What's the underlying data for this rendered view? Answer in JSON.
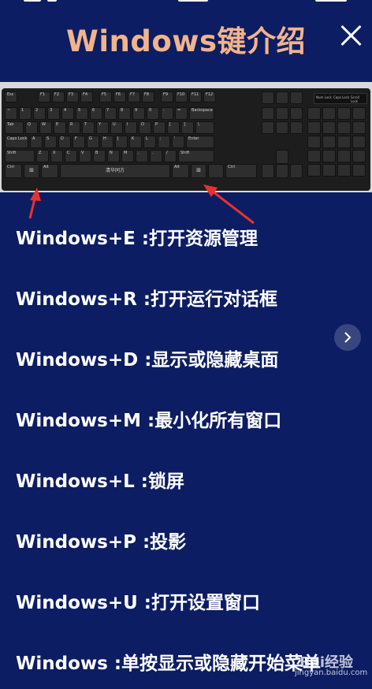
{
  "header": {
    "title": "Windows键介绍"
  },
  "keyboard_image": {
    "space_label": "清华同方",
    "win_key_label": "⊞",
    "fn_keys": [
      "Esc",
      "F1",
      "F2",
      "F3",
      "F4",
      "F5",
      "F6",
      "F7",
      "F8",
      "F9",
      "F10",
      "F11",
      "F12"
    ],
    "row1": [
      "~",
      "1",
      "2",
      "3",
      "4",
      "5",
      "6",
      "7",
      "8",
      "9",
      "0",
      "-",
      "=",
      "Backspace"
    ],
    "row2": [
      "Tab",
      "Q",
      "W",
      "E",
      "R",
      "T",
      "Y",
      "U",
      "I",
      "O",
      "P",
      "[",
      "]",
      "\\"
    ],
    "row3": [
      "Caps Lock",
      "A",
      "S",
      "D",
      "F",
      "G",
      "H",
      "J",
      "K",
      "L",
      ";",
      "'",
      "Enter"
    ],
    "row4": [
      "Shift",
      "Z",
      "X",
      "C",
      "V",
      "B",
      "N",
      "M",
      ",",
      ".",
      "/",
      "Shift"
    ],
    "row5_left": [
      "Ctrl",
      "Alt"
    ],
    "row5_right": [
      "Alt",
      "Ctrl"
    ],
    "led_labels": [
      "Num Lock",
      "Caps Lock",
      "Scroll Lock"
    ]
  },
  "shortcuts": [
    "Windows+E :打开资源管理",
    "Windows+R :打开运行对话框",
    "Windows+D :显示或隐藏桌面",
    "Windows+M :最小化所有窗口",
    "Windows+L :锁屏",
    "Windows+P :投影",
    "Windows+U :打开设置窗口",
    "Windows :单按显示或隐藏开始菜单"
  ],
  "watermark": {
    "logo": "Bai经验",
    "url": "jingyan.baidu.com"
  },
  "colors": {
    "background": "#0d1d63",
    "title": "#f2b48a",
    "arrow": "#e8322d"
  },
  "icons": {
    "close": "close-icon",
    "next": "chevron-right-icon"
  }
}
